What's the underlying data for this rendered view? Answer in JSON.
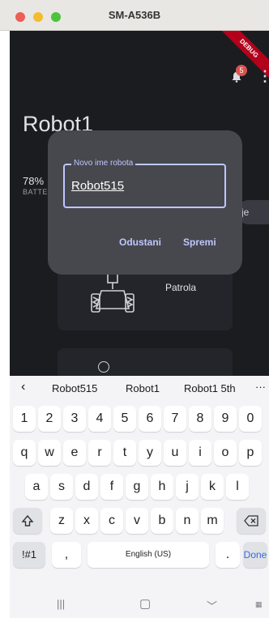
{
  "window": {
    "title": "SM-A536B"
  },
  "app": {
    "debug_banner": "DEBUG",
    "notification_count": "5",
    "robot_name": "Robot1",
    "battery_percent": "78%",
    "battery_label": "BATTE",
    "side_button": "je",
    "cards": [
      {
        "label": "Patrola"
      },
      {
        "label": ""
      }
    ]
  },
  "dialog": {
    "field_label": "Novo ime robota",
    "field_value": "Robot515",
    "cancel_label": "Odustani",
    "save_label": "Spremi"
  },
  "keyboard": {
    "suggestions": [
      "Robot515",
      "Robot1",
      "Robot1 5th"
    ],
    "row1": [
      "1",
      "2",
      "3",
      "4",
      "5",
      "6",
      "7",
      "8",
      "9",
      "0"
    ],
    "row2": [
      "q",
      "w",
      "e",
      "r",
      "t",
      "y",
      "u",
      "i",
      "o",
      "p"
    ],
    "row3": [
      "a",
      "s",
      "d",
      "f",
      "g",
      "h",
      "j",
      "k",
      "l"
    ],
    "row4": [
      "z",
      "x",
      "c",
      "v",
      "b",
      "n",
      "m"
    ],
    "symbols_key": "!#1",
    "comma_key": ",",
    "space_label": "English (US)",
    "period_key": ".",
    "done_key": "Done"
  }
}
